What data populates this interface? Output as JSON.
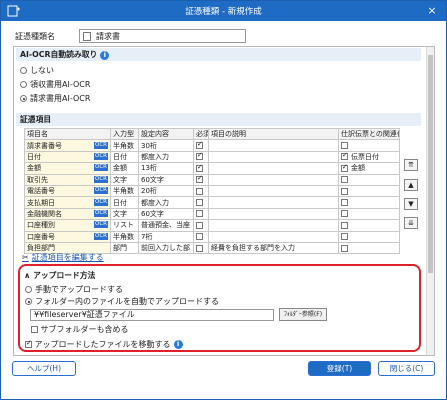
{
  "window": {
    "title": "証憑種類 - 新規作成",
    "close_glyph": "×"
  },
  "name_row": {
    "label": "証憑種類名",
    "value": "請求書"
  },
  "ai_ocr": {
    "header": "AI-OCR自動読み取り",
    "options": [
      {
        "label": "しない",
        "selected": false
      },
      {
        "label": "領収書用AI-OCR",
        "selected": false
      },
      {
        "label": "請求書用AI-OCR",
        "selected": true
      }
    ]
  },
  "items_section": {
    "header": "証憑項目",
    "columns": [
      "項目名",
      "入力型",
      "設定内容",
      "必須",
      "項目の説明",
      "仕訳伝票との関連付け"
    ],
    "ocr_badge": "OCR",
    "rows": [
      {
        "name": "請求書番号",
        "ocr": true,
        "type": "半角数",
        "setting": "30桁",
        "required": true,
        "desc": "",
        "link_checked": false,
        "link": ""
      },
      {
        "name": "日付",
        "ocr": true,
        "type": "日付",
        "setting": "都度入力",
        "required": true,
        "desc": "",
        "link_checked": true,
        "link": "伝票日付"
      },
      {
        "name": "金額",
        "ocr": true,
        "type": "金額",
        "setting": "13桁",
        "required": true,
        "desc": "",
        "link_checked": true,
        "link": "金額"
      },
      {
        "name": "取引先",
        "ocr": true,
        "type": "文字",
        "setting": "60文字",
        "required": true,
        "desc": "",
        "link_checked": false,
        "link": ""
      },
      {
        "name": "電話番号",
        "ocr": true,
        "type": "半角数",
        "setting": "20桁",
        "required": false,
        "desc": "",
        "link_checked": false,
        "link": ""
      },
      {
        "name": "支払期日",
        "ocr": true,
        "type": "日付",
        "setting": "都度入力",
        "required": false,
        "desc": "",
        "link_checked": false,
        "link": ""
      },
      {
        "name": "金融機関名",
        "ocr": true,
        "type": "文字",
        "setting": "60文字",
        "required": false,
        "desc": "",
        "link_checked": false,
        "link": ""
      },
      {
        "name": "口座種別",
        "ocr": true,
        "type": "リスト",
        "setting": "普通預金、当座",
        "required": false,
        "desc": "",
        "link_checked": false,
        "link": ""
      },
      {
        "name": "口座番号",
        "ocr": true,
        "type": "半角数",
        "setting": "7桁",
        "required": false,
        "desc": "",
        "link_checked": false,
        "link": ""
      },
      {
        "name": "負担部門",
        "ocr": false,
        "type": "部門",
        "setting": "前回入力した部",
        "required": false,
        "desc": "経費を負担する部門を入力",
        "link_checked": false,
        "link": ""
      }
    ],
    "side_buttons": [
      "⇈",
      "▲",
      "▼",
      "⇊"
    ],
    "edit_link": "証憑項目を編集する"
  },
  "upload": {
    "header": "アップロード方法",
    "options": [
      {
        "label": "手動でアップロードする",
        "selected": false
      },
      {
        "label": "フォルダー内のファイルを自動でアップロードする",
        "selected": true
      }
    ],
    "path": "¥¥fileserver¥証憑ファイル",
    "browse_label": "ﾌｫﾙﾀﾞｰ参照(F)",
    "subfolder_label": "サブフォルダーも含める",
    "subfolder_checked": false,
    "move_label": "アップロードしたファイルを移動する",
    "move_checked": true
  },
  "buttons": {
    "help": "ヘルプ(H)",
    "register": "登録(T)",
    "close": "閉じる(C)"
  }
}
